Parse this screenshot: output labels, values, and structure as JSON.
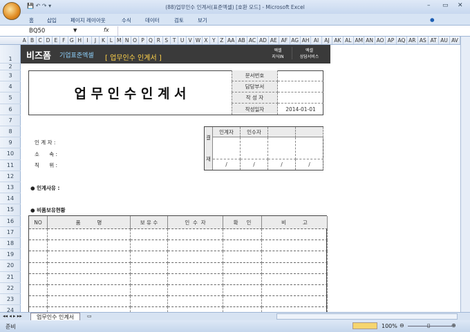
{
  "window": {
    "title": "(88)업무인수 인계서(표준엑셀) [호환 모드] - Microsoft Excel",
    "qat": "▾"
  },
  "ribbon": {
    "tabs": [
      "홈",
      "삽입",
      "페이지 레이아웃",
      "수식",
      "데이터",
      "검토",
      "보기"
    ]
  },
  "formula": {
    "name_box": "BQ50",
    "fx": "fx",
    "value": ""
  },
  "columns": [
    "A",
    "B",
    "C",
    "D",
    "E",
    "F",
    "G",
    "H",
    "I",
    "J",
    "K",
    "L",
    "M",
    "N",
    "O",
    "P",
    "Q",
    "R",
    "S",
    "T",
    "U",
    "V",
    "W",
    "X",
    "Y",
    "Z",
    "AA",
    "AB",
    "AC",
    "AD",
    "AE",
    "AF",
    "AG",
    "AH",
    "AI",
    "AJ",
    "AK",
    "AL",
    "AM",
    "AN",
    "AO",
    "AP",
    "AQ",
    "AR",
    "AS",
    "AT",
    "AU",
    "AV"
  ],
  "rows": [
    "1",
    "2",
    "3",
    "4",
    "5",
    "6",
    "7",
    "8",
    "9",
    "10",
    "11",
    "12",
    "13",
    "14",
    "15",
    "16",
    "17",
    "18",
    "19",
    "20",
    "21",
    "22",
    "23",
    "24"
  ],
  "banner": {
    "brand": "비즈폼",
    "sub": "기업표준엑셀",
    "doc": "[ 업무인수 인계서 ]",
    "btn1_l1": "엑셀",
    "btn1_l2": "지식IN",
    "btn2_l1": "엑셀",
    "btn2_l2": "상담서비스"
  },
  "doc": {
    "title": "업 무 인 수 인 계 서",
    "info": [
      {
        "label": "문서번호",
        "value": ""
      },
      {
        "label": "담당부서",
        "value": ""
      },
      {
        "label": "작 성 자",
        "value": ""
      },
      {
        "label": "작성일자",
        "value": "2014-01-01"
      }
    ],
    "fields": [
      {
        "label": "인 계 자 :"
      },
      {
        "label": "소      속 :"
      },
      {
        "label": "직      위 :"
      }
    ],
    "approval": {
      "side1": "결",
      "side2": "재",
      "headers": [
        "인계자",
        "인수자",
        "",
        ""
      ],
      "date_marks": [
        "/",
        "/",
        "/",
        "/"
      ]
    },
    "reason_label": "● 인계사유 :",
    "inventory_label": "● 비품보유현황",
    "table_headers": [
      "NO",
      "품          명",
      "보 유 수",
      "인  수  자",
      "확     인",
      "비          고"
    ]
  },
  "sheets": {
    "tabs": [
      "업무인수 인계서"
    ]
  },
  "status": {
    "ready": "준비",
    "zoom": "100%"
  }
}
